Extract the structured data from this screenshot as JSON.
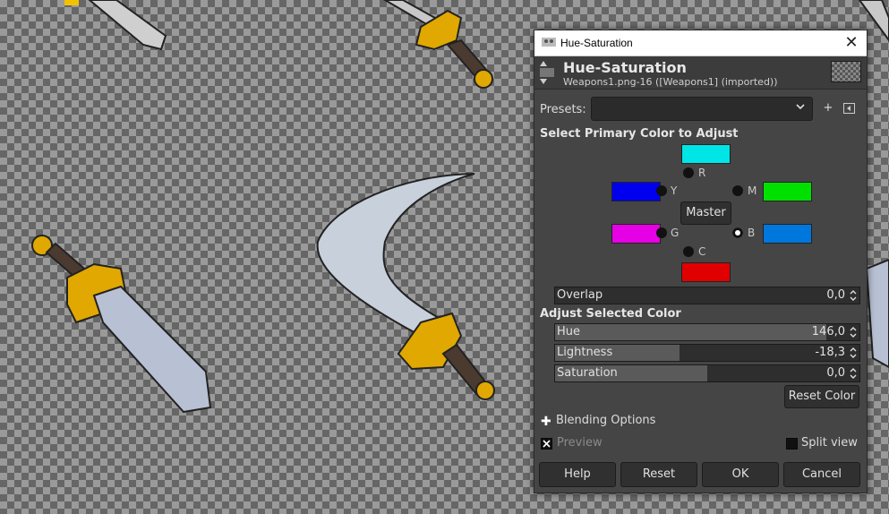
{
  "dialog": {
    "window_title": "Hue-Saturation",
    "header_title": "Hue-Saturation",
    "header_subtitle": "Weapons1.png-16 ([Weapons1] (imported))",
    "presets_label": "Presets:",
    "presets_value": "",
    "primary_section": "Select Primary Color to Adjust",
    "radios": {
      "R": "R",
      "Y": "Y",
      "M": "M",
      "G": "G",
      "B": "B",
      "C": "C",
      "selected": "B"
    },
    "master_label": "Master",
    "swatch_colors": {
      "R": "#00e5e5",
      "Y": "#0000ee",
      "M": "#00e000",
      "G": "#e600e6",
      "B": "#0077dd",
      "C": "#e00000"
    },
    "overlap": {
      "label": "Overlap",
      "value": "0,0",
      "fraction": 0
    },
    "adjust_section": "Adjust Selected Color",
    "hue": {
      "label": "Hue",
      "value": "146,0",
      "fraction": 0.89
    },
    "lightness": {
      "label": "Lightness",
      "value": "-18,3",
      "fraction": 0.41
    },
    "saturation": {
      "label": "Saturation",
      "value": "0,0",
      "fraction": 0.5
    },
    "reset_color_label": "Reset Color",
    "blending_options_label": "Blending Options",
    "preview_label": "Preview",
    "split_view_label": "Split view",
    "buttons": {
      "help": "Help",
      "reset": "Reset",
      "ok": "OK",
      "cancel": "Cancel"
    }
  }
}
